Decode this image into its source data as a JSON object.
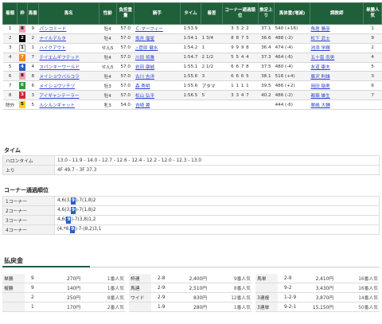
{
  "results": {
    "headers": [
      "着順",
      "枠",
      "馬番",
      "馬名",
      "性齢",
      "負担重量",
      "騎手",
      "タイム",
      "着差",
      "コーナー通過順位",
      "推定上り",
      "馬体重(増減)",
      "調教師",
      "単勝人気"
    ],
    "rows": [
      {
        "rank": "1",
        "waku": "8",
        "num": "9",
        "name": "パンコミード",
        "sexage": "牡4",
        "weight": "57.0",
        "jockey": "Ｃ.マーフィー",
        "time": "1:53.9",
        "margin": "",
        "corners": "3 3 2 2",
        "last3f": "37.1",
        "body": "540 (+16)",
        "trainer": "角居 勝彦",
        "fav": "1"
      },
      {
        "rank": "2",
        "waku": "2",
        "num": "2",
        "name": "ナイルデルタ",
        "sexage": "牡4",
        "weight": "57.0",
        "jockey": "坂井 瑠星",
        "time": "1:54.1",
        "margin": "1 3/4",
        "corners": "8 8 7 5",
        "last3f": "36.6",
        "body": "488 (-2)",
        "trainer": "松下 武士",
        "fav": "9"
      },
      {
        "rank": "3",
        "waku": "1",
        "num": "1",
        "name": "ハイクアウト",
        "sexage": "せん5",
        "weight": "57.0",
        "jockey": "△菅原 健水",
        "time": "1:54.2",
        "margin": "1",
        "corners": "9 9 9 8",
        "last3f": "36.4",
        "body": "474 (-4)",
        "trainer": "池添 学輝",
        "fav": "2"
      },
      {
        "rank": "4",
        "waku": "7",
        "num": "7",
        "name": "テイエムギフテッド",
        "sexage": "牡4",
        "weight": "57.0",
        "jockey": "川田 将雅",
        "time": "1:54.7",
        "margin": "2 1/2",
        "corners": "5 5 4 4",
        "last3f": "37.3",
        "body": "464 (-6)",
        "trainer": "五十嵐 忠男",
        "fav": "4"
      },
      {
        "rank": "5",
        "waku": "4",
        "num": "4",
        "name": "スパンキーワールド",
        "sexage": "せん5",
        "weight": "57.0",
        "jockey": "岩田 康誠",
        "time": "1:55.1",
        "margin": "2 1/2",
        "corners": "6 6 7 8",
        "last3f": "37.5",
        "body": "480 (-4)",
        "trainer": "友道 康夫",
        "fav": "5"
      },
      {
        "rank": "6",
        "waku": "8",
        "num": "8",
        "name": "メイショウバルコラ",
        "sexage": "牡4",
        "weight": "57.0",
        "jockey": "古川 吉洋",
        "time": "1:55.6",
        "margin": "3",
        "corners": "6 6 6 5",
        "last3f": "38.1",
        "body": "516 (+4)",
        "trainer": "藤沢 則雄",
        "fav": "3"
      },
      {
        "rank": "7",
        "waku": "6",
        "num": "6",
        "name": "メイショウソチヅ",
        "sexage": "牡3",
        "weight": "57.0",
        "jockey": "森 秀明",
        "time": "1:55.6",
        "margin": "アタマ",
        "corners": "1 1 1 1",
        "last3f": "39.5",
        "body": "486 (+2)",
        "trainer": "岡田 稲男",
        "fav": "6"
      },
      {
        "rank": "8",
        "waku": "3",
        "num": "3",
        "name": "アイギャンテーラー",
        "sexage": "牡4",
        "weight": "57.0",
        "jockey": "松山 弘平",
        "time": "1:56.5",
        "margin": "5",
        "corners": "3 3 4 7",
        "last3f": "40.2",
        "body": "486 (-2)",
        "trainer": "都築 雄生",
        "fav": "7"
      },
      {
        "rank": "除外",
        "waku": "5",
        "num": "5",
        "name": "ルシルンギャット",
        "sexage": "牝3",
        "weight": "54.0",
        "jockey": "吉崎 翼",
        "time": "",
        "margin": "",
        "corners": "",
        "last3f": "",
        "body": "444 (-6)",
        "trainer": "栗嶋 大輔",
        "fav": ""
      }
    ]
  },
  "lap": {
    "title": "タイム",
    "rows": [
      {
        "key": "ハロンタイム",
        "value": "13.0 - 11.9 - 14.0 - 12.7 - 12.6 - 12.4 - 12.2 - 12.0 - 12.3 - 13.0"
      },
      {
        "key": "上り",
        "value": "4F 49.7 - 3F 37.3"
      }
    ]
  },
  "corners": {
    "title": "コーナー通過順位",
    "rows": [
      {
        "key": "1コーナー",
        "pre": "4,6(3,",
        "hl": "9",
        "post": ")-7(1,8)2"
      },
      {
        "key": "2コーナー",
        "pre": "4,6(3,",
        "hl": "9",
        "post": ")-7(1,8)2"
      },
      {
        "key": "3コーナー",
        "pre": "4,6(",
        "hl": "9",
        "post": ")-7(3,8)1,2"
      },
      {
        "key": "4コーナー",
        "pre": "(4,*6,",
        "hl": "9",
        "post": ")-7-(8,2)3,1"
      }
    ]
  },
  "payout": {
    "title": "払戻金",
    "col1": [
      {
        "type": "単勝",
        "num": "9",
        "yen": "270円",
        "pop": "1番人気"
      },
      {
        "type": "複勝",
        "num": "9",
        "yen": "140円",
        "pop": "1番人気"
      },
      {
        "type": "",
        "num": "2",
        "yen": "250円",
        "pop": "8番人気"
      },
      {
        "type": "",
        "num": "1",
        "yen": "170円",
        "pop": "2番人気"
      }
    ],
    "col2": [
      {
        "type": "枠連",
        "num": "2-8",
        "yen": "2,400円",
        "pop": "9番人気"
      },
      {
        "type": "馬連",
        "num": "2-9",
        "yen": "2,510円",
        "pop": "8番人気"
      },
      {
        "type": "ワイド",
        "num": "2-9",
        "yen": "830円",
        "pop": "12番人気"
      },
      {
        "type": "",
        "num": "1-9",
        "yen": "280円",
        "pop": "1番人気"
      }
    ],
    "col3": [
      {
        "type": "馬単",
        "num": "2-9",
        "yen": "2,410円",
        "pop": "16番人気"
      },
      {
        "type": "",
        "num": "9-2",
        "yen": "3,430円",
        "pop": "16番人気"
      },
      {
        "type": "3連複",
        "num": "1-2-9",
        "yen": "3,870円",
        "pop": "14番人気"
      },
      {
        "type": "3連単",
        "num": "9-2-1",
        "yen": "15,150円",
        "pop": "50番人気"
      }
    ]
  },
  "colors": {
    "header_green": "#1f5f3a",
    "link_blue": "#2b3fd0",
    "highlight_blue": "#2a5fc9"
  }
}
